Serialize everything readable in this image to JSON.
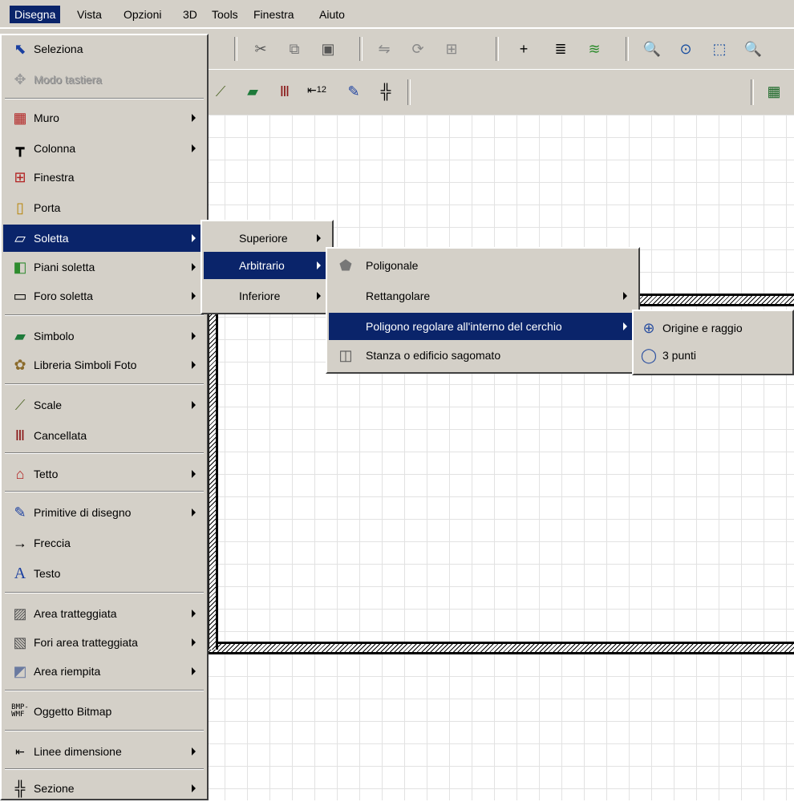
{
  "menubar": [
    "Disegna",
    "Vista",
    "Opzioni",
    "3D",
    "Tools",
    "Finestra",
    "Aiuto"
  ],
  "disegna_menu": {
    "items": [
      {
        "label": "Seleziona",
        "icon": "arrow-cursor-icon",
        "arrow": false,
        "disabled": false
      },
      {
        "label": "Modo tastiera",
        "icon": "keyboard-move-icon",
        "arrow": false,
        "disabled": true
      },
      {
        "label": "Muro",
        "icon": "brick-wall-icon",
        "arrow": true
      },
      {
        "label": "Colonna",
        "icon": "column-icon",
        "arrow": true
      },
      {
        "label": "Finestra",
        "icon": "window-icon",
        "arrow": false
      },
      {
        "label": "Porta",
        "icon": "door-icon",
        "arrow": false
      },
      {
        "label": "Soletta",
        "icon": "slab-icon",
        "arrow": true,
        "highlighted": true
      },
      {
        "label": "Piani soletta",
        "icon": "slab-floors-icon",
        "arrow": true
      },
      {
        "label": "Foro soletta",
        "icon": "slab-hole-icon",
        "arrow": true
      },
      {
        "label": "Simbolo",
        "icon": "symbol-icon",
        "arrow": true
      },
      {
        "label": "Libreria Simboli Foto",
        "icon": "plant-photo-icon",
        "arrow": true
      },
      {
        "label": "Scale",
        "icon": "stairs-icon",
        "arrow": true
      },
      {
        "label": "Cancellata",
        "icon": "railing-icon",
        "arrow": false
      },
      {
        "label": "Tetto",
        "icon": "roof-icon",
        "arrow": true
      },
      {
        "label": "Primitive di disegno",
        "icon": "pencil-icon",
        "arrow": true
      },
      {
        "label": "Freccia",
        "icon": "arrow-right-icon",
        "arrow": false
      },
      {
        "label": "Testo",
        "icon": "text-a-icon",
        "arrow": false
      },
      {
        "label": "Area tratteggiata",
        "icon": "hatched-area-icon",
        "arrow": true
      },
      {
        "label": "Fori area tratteggiata",
        "icon": "hatched-hole-icon",
        "arrow": true
      },
      {
        "label": "Area riempita",
        "icon": "filled-area-icon",
        "arrow": true
      },
      {
        "label": "Oggetto Bitmap",
        "icon": "bitmap-icon",
        "arrow": false,
        "icon_text": "BMP-\nWMF"
      },
      {
        "label": "Linee dimensione",
        "icon": "dimension-lines-icon",
        "arrow": true
      },
      {
        "label": "Sezione",
        "icon": "section-icon",
        "arrow": true
      }
    ]
  },
  "soletta_submenu": {
    "items": [
      {
        "label": "Superiore",
        "arrow": true
      },
      {
        "label": "Arbitrario",
        "arrow": true,
        "highlighted": true
      },
      {
        "label": "Inferiore",
        "arrow": true
      }
    ]
  },
  "arbitrario_submenu": {
    "items": [
      {
        "label": "Poligonale",
        "icon": "polygon-icon",
        "arrow": false
      },
      {
        "label": "Rettangolare",
        "icon": "",
        "arrow": true
      },
      {
        "label": "Poligono regolare all'interno del cerchio",
        "icon": "",
        "arrow": true,
        "highlighted": true
      },
      {
        "label": "Stanza o edificio sagomato",
        "icon": "room-shape-icon",
        "arrow": false
      }
    ]
  },
  "poligono_submenu": {
    "items": [
      {
        "label": "Origine e raggio",
        "icon": "circle-origin-radius-icon"
      },
      {
        "label": "3 punti",
        "icon": "circle-3-points-icon"
      }
    ]
  },
  "toolbar2": {
    "dimension_label": "12"
  },
  "colors": {
    "menu_bg": "#d4d0c8",
    "highlight": "#0a246a",
    "grid": "#e2e2e2"
  }
}
